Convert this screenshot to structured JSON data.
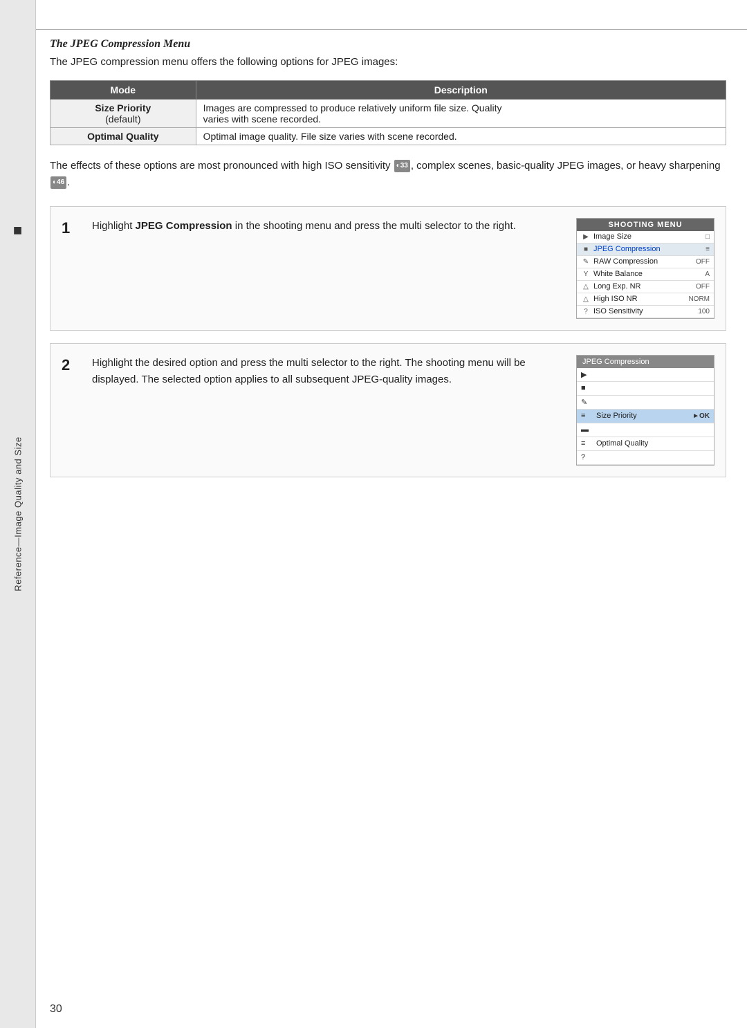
{
  "sidebar": {
    "camera_icon": "📷",
    "rotated_text": "Reference—Image Quality and Size"
  },
  "page": {
    "number": "30",
    "top_line": true
  },
  "section": {
    "title": "The JPEG Compression Menu",
    "intro": "The JPEG compression menu offers the following options for JPEG images:"
  },
  "table": {
    "headers": [
      "Mode",
      "Description"
    ],
    "rows": [
      {
        "mode": "Size Priority",
        "mode_sub": "(default)",
        "description1": "Images are compressed to produce relatively uniform file size.  Quality",
        "description2": "varies with scene recorded."
      },
      {
        "mode": "Optimal Quality",
        "description": "Optimal image quality.  File size varies with scene recorded."
      }
    ]
  },
  "effects_text": "The effects of these options are most pronounced with high ISO sensitivity (",
  "effects_text2": " 33), complex scenes, basic-quality JPEG images, or heavy sharpening (",
  "effects_text3": " 46).",
  "steps": [
    {
      "number": "1",
      "text_before": "Highlight ",
      "bold": "JPEG Compression",
      "text_after": " in the shooting menu and press the multi selector to the right.",
      "menu": {
        "header": "SHOOTING MENU",
        "items": [
          {
            "icon": "▶",
            "label": "Image Size",
            "value": "□",
            "highlighted": false
          },
          {
            "icon": "📷",
            "label": "JPEG Compression",
            "value": "≡·",
            "highlighted": true
          },
          {
            "icon": "✏",
            "label": "RAW Compression",
            "value": "OFF",
            "highlighted": false
          },
          {
            "icon": "Y",
            "label": "White Balance",
            "value": "A",
            "highlighted": false
          },
          {
            "icon": "□",
            "label": "Long Exp. NR",
            "value": "OFF",
            "highlighted": false
          },
          {
            "icon": "□",
            "label": "High ISO NR",
            "value": "NORM",
            "highlighted": false
          },
          {
            "icon": "?",
            "label": "ISO Sensitivity",
            "value": "100",
            "highlighted": false
          }
        ]
      }
    },
    {
      "number": "2",
      "text": "Highlight the desired option and press the multi selector to the right.  The shooting menu will be displayed.  The selected option applies to all subsequent JPEG-quality images.",
      "menu": {
        "header": "JPEG Compression",
        "items": [
          {
            "icon": "▶",
            "label": "",
            "highlighted": false
          },
          {
            "icon": "📷",
            "label": "",
            "highlighted": false
          },
          {
            "icon": "✏",
            "label": "",
            "highlighted": false
          },
          {
            "icon": "≡·",
            "label": "Size Priority",
            "ok": "▶OK",
            "highlighted": true
          },
          {
            "icon": "□",
            "label": "",
            "highlighted": false
          },
          {
            "icon": "≡·",
            "label": "Optimal Quality",
            "highlighted": false
          },
          {
            "icon": "?",
            "label": "",
            "highlighted": false
          }
        ]
      }
    }
  ]
}
